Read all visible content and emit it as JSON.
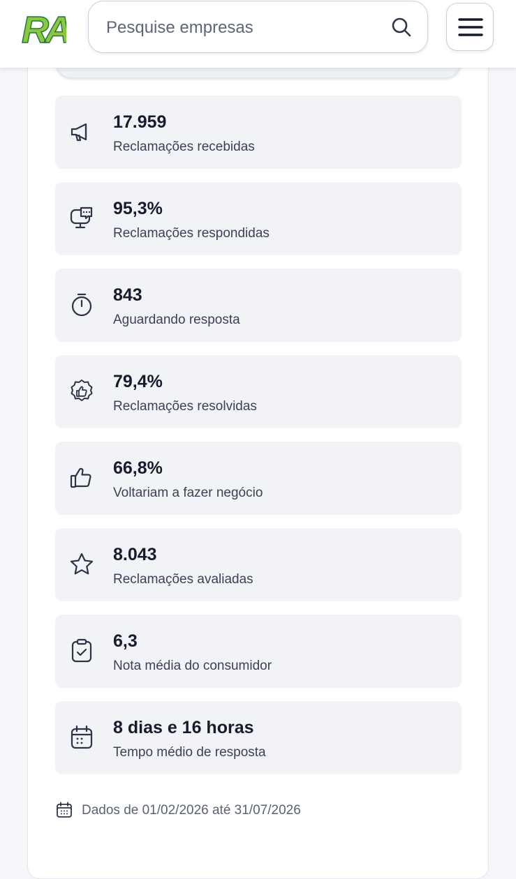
{
  "header": {
    "logo_text": "RA",
    "search_placeholder": "Pesquise empresas"
  },
  "stats": [
    {
      "icon": "megaphone-icon",
      "value": "17.959",
      "label": "Reclamações recebidas"
    },
    {
      "icon": "chat-monitor-icon",
      "value": "95,3%",
      "label": "Reclamações respondidas"
    },
    {
      "icon": "stopwatch-icon",
      "value": "843",
      "label": "Aguardando resposta"
    },
    {
      "icon": "badge-thumbs-up-icon",
      "value": "79,4%",
      "label": "Reclamações resolvidas"
    },
    {
      "icon": "thumbs-up-icon",
      "value": "66,8%",
      "label": "Voltariam a fazer negócio"
    },
    {
      "icon": "star-icon",
      "value": "8.043",
      "label": "Reclamações avaliadas"
    },
    {
      "icon": "clipboard-check-icon",
      "value": "6,3",
      "label": "Nota média do consumidor"
    },
    {
      "icon": "calendar-icon",
      "value": "8 dias e 16 horas",
      "label": "Tempo médio de resposta"
    }
  ],
  "footer": {
    "icon": "calendar-small-icon",
    "text": "Dados de 01/02/2026 até 31/07/2026"
  },
  "colors": {
    "brand_green": "#8dc63f",
    "brand_dark_green": "#1e7a3a",
    "card_bg": "#f1f3f7",
    "text_primary": "#161c2b"
  }
}
